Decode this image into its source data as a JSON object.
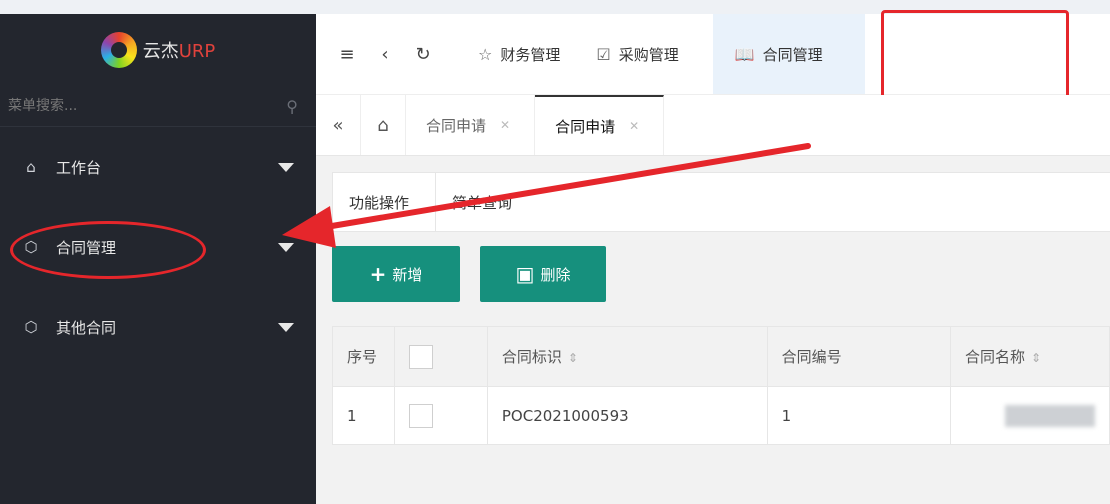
{
  "brand": {
    "name_cn": "云杰",
    "name_en": "URP"
  },
  "sidebar": {
    "search_placeholder": "菜单搜索...",
    "items": [
      {
        "label": "工作台",
        "icon": "home-icon"
      },
      {
        "label": "合同管理",
        "icon": "cube-icon"
      },
      {
        "label": "其他合同",
        "icon": "cube-icon"
      }
    ]
  },
  "header": {
    "modules": [
      {
        "label": "财务管理",
        "icon": "star-icon"
      },
      {
        "label": "采购管理",
        "icon": "shield-check-icon"
      },
      {
        "label": "合同管理",
        "icon": "book-icon",
        "active": true
      }
    ]
  },
  "tabs": [
    {
      "label": "合同申请"
    },
    {
      "label": "合同申请",
      "active": true
    }
  ],
  "subtabs": [
    "功能操作",
    "简单查询"
  ],
  "actions": {
    "add": "新增",
    "delete": "删除"
  },
  "table": {
    "columns": [
      "序号",
      "合同标识",
      "合同编号",
      "合同名称"
    ],
    "rows": [
      {
        "index": "1",
        "id": "POC2021000593",
        "number": "1"
      }
    ]
  },
  "colors": {
    "sidebar_bg": "#23262e",
    "accent": "#16907d",
    "annotation": "#e5262b",
    "active_module_bg": "#e9f2fb"
  }
}
